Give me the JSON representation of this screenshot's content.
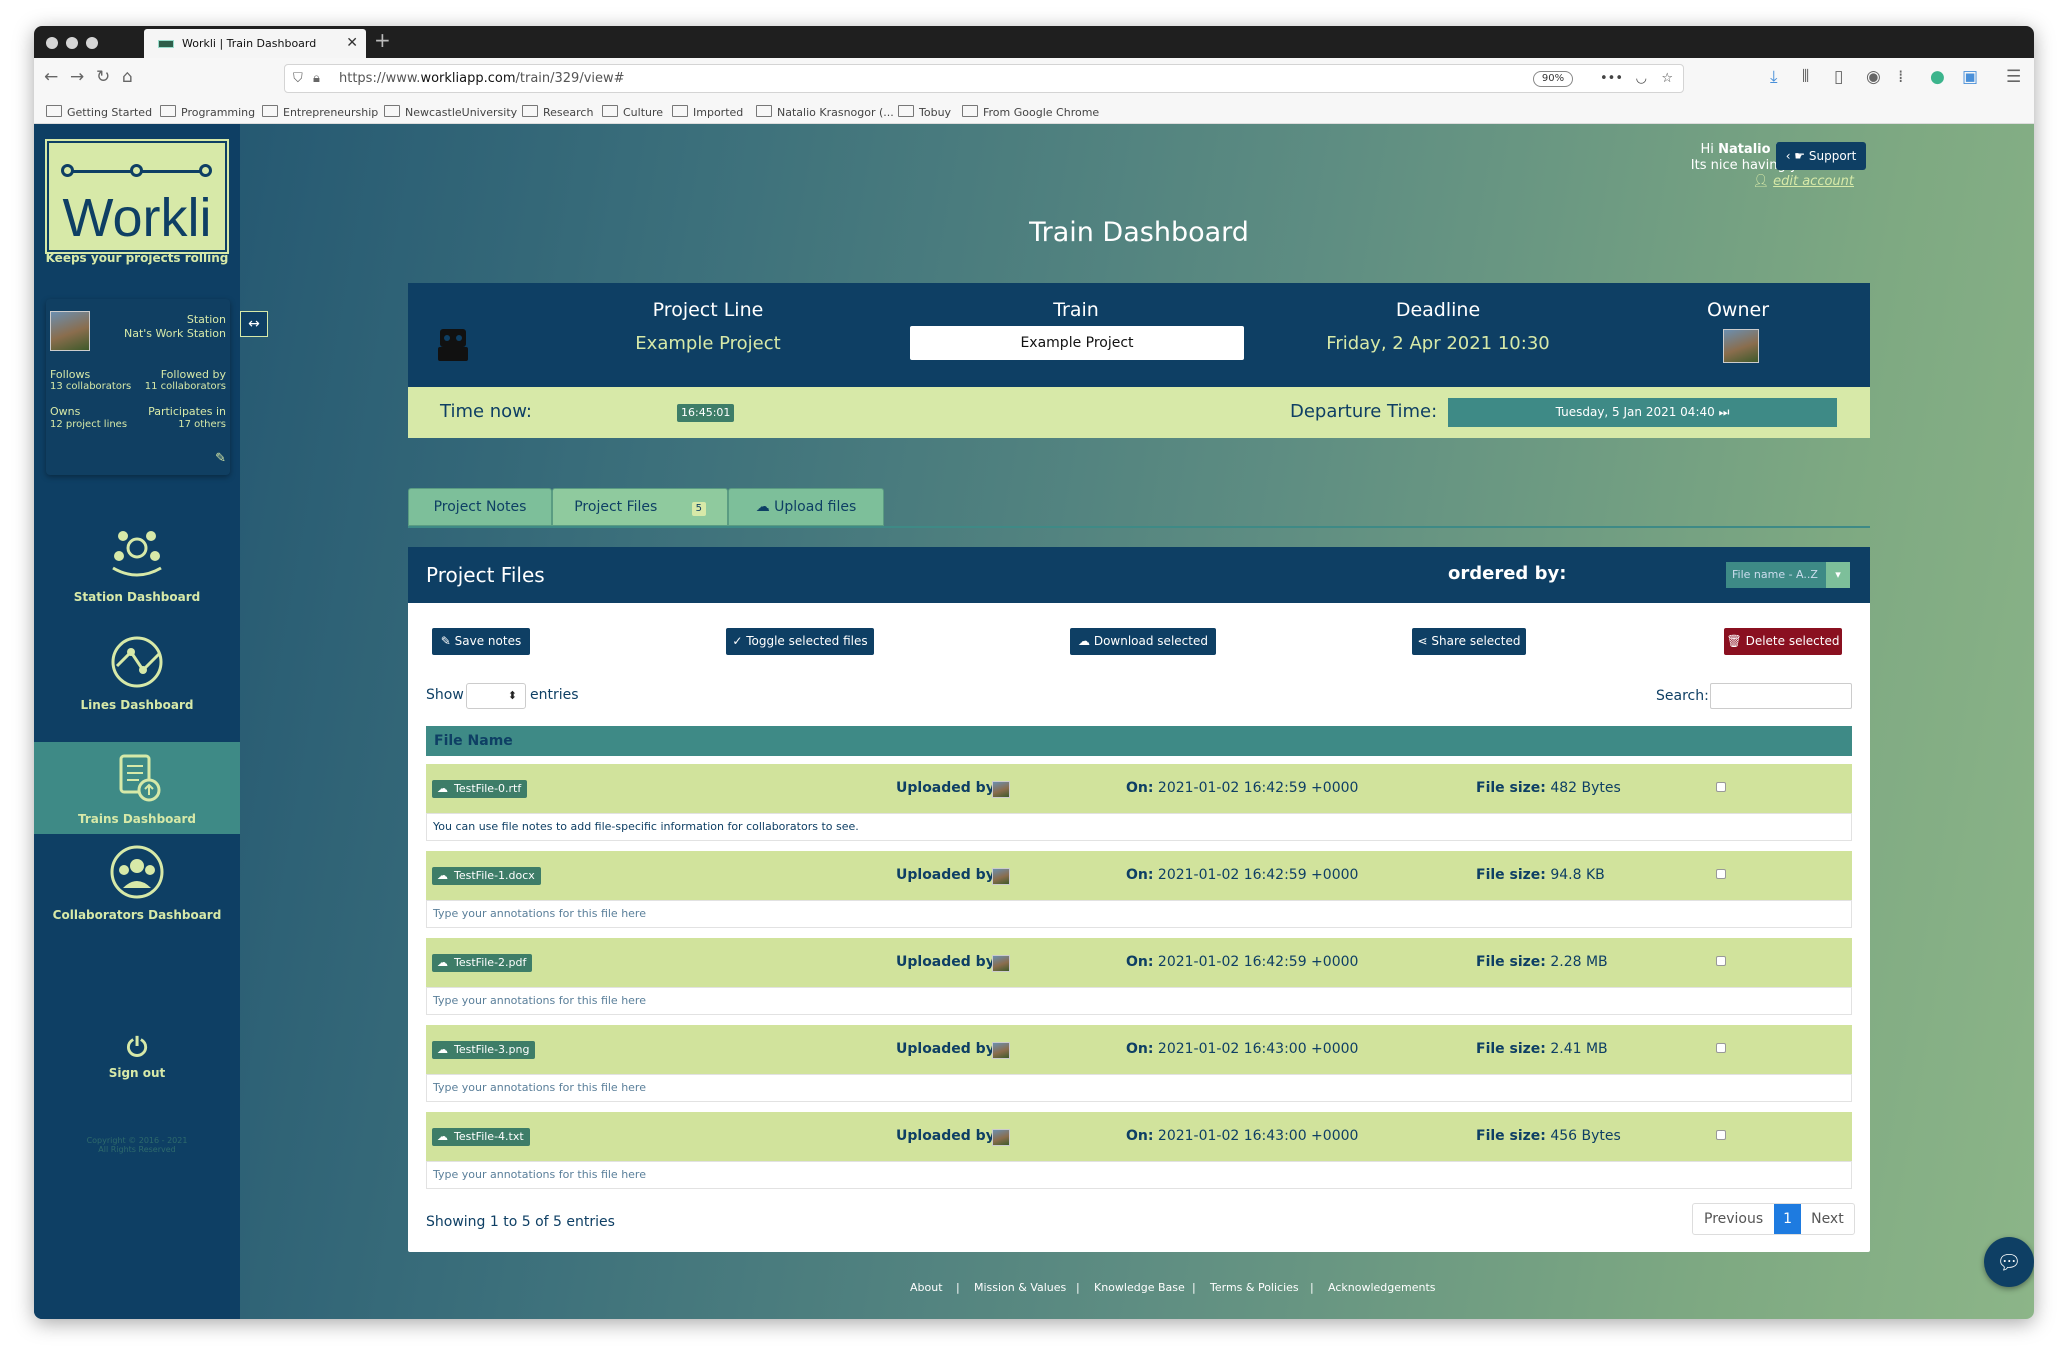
{
  "browser": {
    "tab_title": "Workli | Train Dashboard",
    "url_prefix": "https://www.",
    "url_domain": "workliapp.com",
    "url_path": "/train/329/view#",
    "zoom": "90%",
    "bookmarks": [
      "Getting Started",
      "Programming",
      "Entrepreneurship",
      "NewcastleUniversity",
      "Research",
      "Culture",
      "Imported",
      "Natalio Krasnogor (...",
      "Tobuy",
      "From Google Chrome"
    ]
  },
  "sidebar": {
    "logo_text": "Workli",
    "tagline": "Keeps your projects rolling",
    "station_label": "Station",
    "station_name": "Nat's Work Station",
    "follows_label": "Follows",
    "follows_value": "13 collaborators",
    "followed_label": "Followed by",
    "followed_value": "11 collaborators",
    "owns_label": "Owns",
    "owns_value": "12 project lines",
    "participates_label": "Participates in",
    "participates_value": "17 others",
    "nav": [
      "Station Dashboard",
      "Lines Dashboard",
      "Trains Dashboard",
      "Collaborators Dashboard"
    ],
    "sign_out": "Sign out",
    "copyright_1": "Copyright © 2016 - 2021",
    "copyright_2": "All Rights Reserved"
  },
  "header": {
    "greeting_prefix": "Hi ",
    "user_name": "Natalio Krasnogor.",
    "greeting_line2": "Its nice having you back!",
    "edit_account": "edit account",
    "support": "Support",
    "page_title": "Train Dashboard"
  },
  "project": {
    "line_label": "Project Line",
    "line_value": "Example Project",
    "train_label": "Train",
    "train_value": "Example Project",
    "deadline_label": "Deadline",
    "deadline_value": "Friday, 2 Apr 2021 10:30",
    "owner_label": "Owner",
    "time_now_label": "Time now:",
    "time_now_value": "16:45:01",
    "departure_label": "Departure Time:",
    "departure_value": "Tuesday, 5 Jan 2021 04:40 ⏭"
  },
  "tabs": {
    "notes": "Project Notes",
    "files": "Project Files",
    "files_count": "5",
    "upload": "Upload files"
  },
  "files": {
    "title": "Project Files",
    "ordered_by": "ordered by:",
    "order_value": "File name - A..Z",
    "buttons": {
      "save": "Save notes",
      "toggle": "Toggle selected files",
      "download": "Download selected",
      "share": "Share selected",
      "delete": "Delete selected"
    },
    "show": "Show",
    "entries": "entries",
    "search": "Search:",
    "column": "File Name",
    "uploaded_by": "Uploaded by:",
    "on": "On:",
    "file_size": "File size:",
    "rows": [
      {
        "name": "TestFile-0.rtf",
        "date": "2021-01-02 16:42:59 +0000",
        "size": "482 Bytes",
        "note": "You can use file notes to add file-specific information for collaborators to see."
      },
      {
        "name": "TestFile-1.docx",
        "date": "2021-01-02 16:42:59 +0000",
        "size": "94.8 KB",
        "note": "Type your annotations for this file here"
      },
      {
        "name": "TestFile-2.pdf",
        "date": "2021-01-02 16:42:59 +0000",
        "size": "2.28 MB",
        "note": "Type your annotations for this file here"
      },
      {
        "name": "TestFile-3.png",
        "date": "2021-01-02 16:43:00 +0000",
        "size": "2.41 MB",
        "note": "Type your annotations for this file here"
      },
      {
        "name": "TestFile-4.txt",
        "date": "2021-01-02 16:43:00 +0000",
        "size": "456 Bytes",
        "note": "Type your annotations for this file here"
      }
    ],
    "showing": "Showing 1 to 5 of 5 entries",
    "prev": "Previous",
    "page": "1",
    "next": "Next"
  },
  "footer": [
    "About",
    "Mission & Values",
    "Knowledge Base",
    "Terms & Policies",
    "Acknowledgements"
  ]
}
